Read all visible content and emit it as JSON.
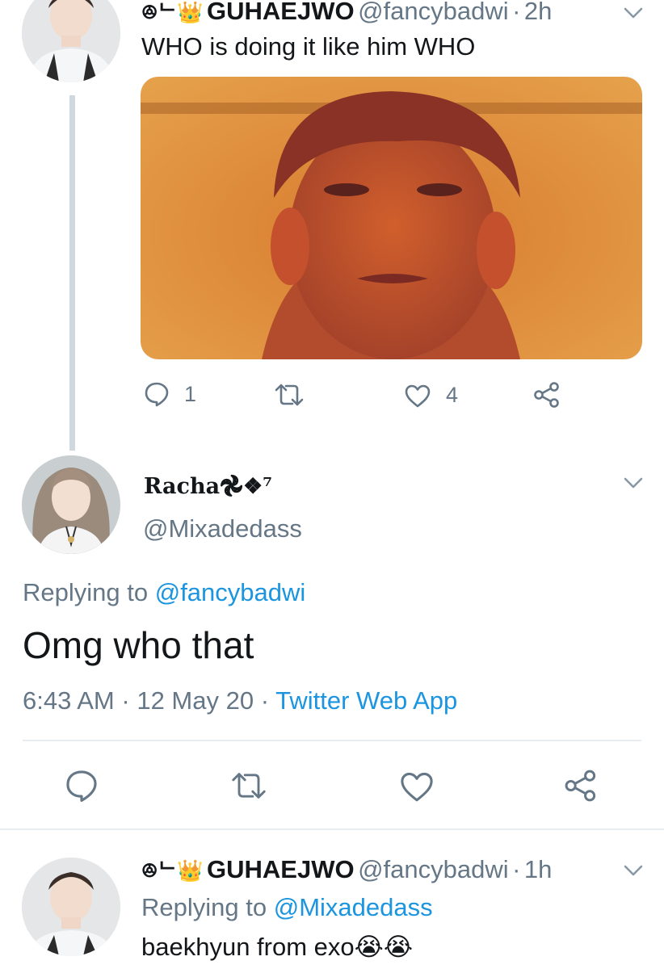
{
  "tweet1": {
    "badge": "ꔮᄂ👑",
    "name": "GUHAEJWO",
    "handle": "@fancybadwi",
    "sep": "·",
    "time": "2h",
    "text": "WHO is doing it like him WHO",
    "reply_count": "1",
    "retweet_count": "",
    "like_count": "4"
  },
  "tweet2": {
    "name": "Racha𖣘❖⁷",
    "handle": "@Mixadedass",
    "replying_prefix": "Replying to",
    "replying_to": "@fancybadwi",
    "text": "Omg who that",
    "time": "6:43 AM",
    "date": "12 May 20",
    "sep": "·",
    "source": "Twitter Web App"
  },
  "tweet3": {
    "badge": "ꔮᄂ👑",
    "name": "GUHAEJWO",
    "handle": "@fancybadwi",
    "sep": "·",
    "time": "1h",
    "replying_prefix": "Replying to",
    "replying_to": "@Mixadedass",
    "text": "baekhyun from exo😭😭"
  },
  "colors": {
    "accent": "#1b95e0",
    "secondary": "#657786",
    "divider": "#e6ecf0"
  }
}
